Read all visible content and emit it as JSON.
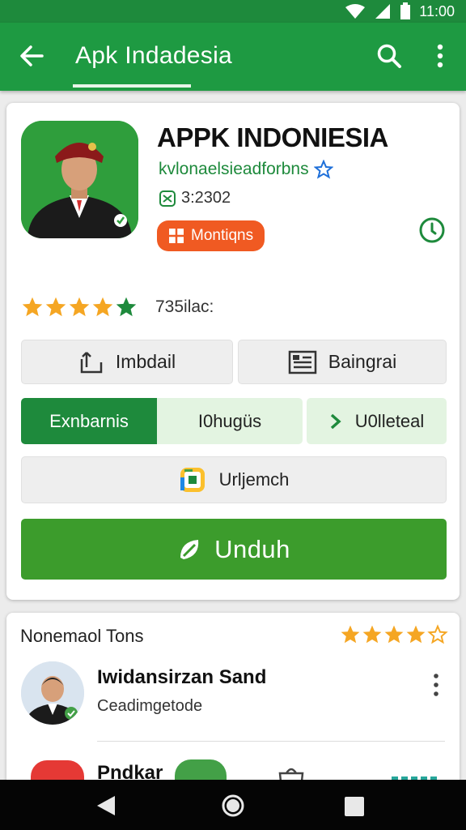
{
  "status_bar": {
    "time": "11:00"
  },
  "app_bar": {
    "title": "Apk Indadesia"
  },
  "app": {
    "title": "APPK INDONIESIA",
    "developer": "kvlonaelsieadforbns",
    "size_meta": "3:2302",
    "category_label": "Montiqns",
    "rating_value": 4.5,
    "rating_count": "735ilac:"
  },
  "actions": {
    "btn1_label": "Imbdail",
    "btn2_label": "Baingrai",
    "seg_a_label": "Exnbarnis",
    "seg_b_label": "I0hugüs",
    "btn3_label": "U0lleteal",
    "btn4_label": "Urljemch",
    "download_label": "Unduh"
  },
  "reviews": {
    "section_title": "Nonemaol Tons",
    "rating_value": 4,
    "reviewer_name": "Iwidansirzan Sand",
    "reviewer_sub": "Ceadimgetode",
    "next_name": "Pndkar"
  },
  "colors": {
    "brand_green": "#1e9a42",
    "download_green": "#3c9c2c",
    "badge_orange": "#f05a22",
    "star_gold": "#f5a623"
  },
  "icons": [
    "back-arrow-icon",
    "search-icon",
    "more-vert-icon",
    "verified-star-icon",
    "download-size-icon",
    "clock-icon",
    "share-icon",
    "document-icon",
    "chevron-right-icon",
    "play-store-icon",
    "download-leaf-icon",
    "nav-back-icon",
    "nav-home-icon",
    "nav-recent-icon"
  ]
}
